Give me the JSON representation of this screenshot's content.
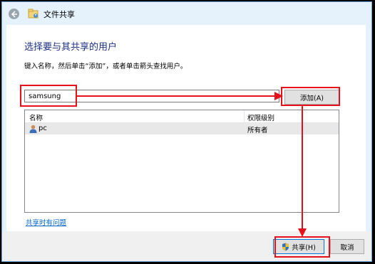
{
  "window": {
    "title": "文件共享"
  },
  "main": {
    "heading": "选择要与其共享的用户",
    "instruction": "键入名称，然后单击“添加”，或者单击箭头查找用户。",
    "name_input_value": "samsung",
    "add_button_label": "添加(A)"
  },
  "list": {
    "columns": [
      "名称",
      "权限级别"
    ],
    "rows": [
      {
        "name": "pc",
        "permission": "所有者"
      }
    ]
  },
  "help_link": "共享时有问题",
  "footer": {
    "share_button_label": "共享(H)",
    "cancel_button_label": "取消"
  },
  "colors": {
    "annotation": "#e8101a",
    "heading": "#1e3287",
    "link": "#0066cc"
  },
  "icons": [
    "back-arrow-icon",
    "file-share-app-icon",
    "user-icon",
    "shield-icon"
  ]
}
